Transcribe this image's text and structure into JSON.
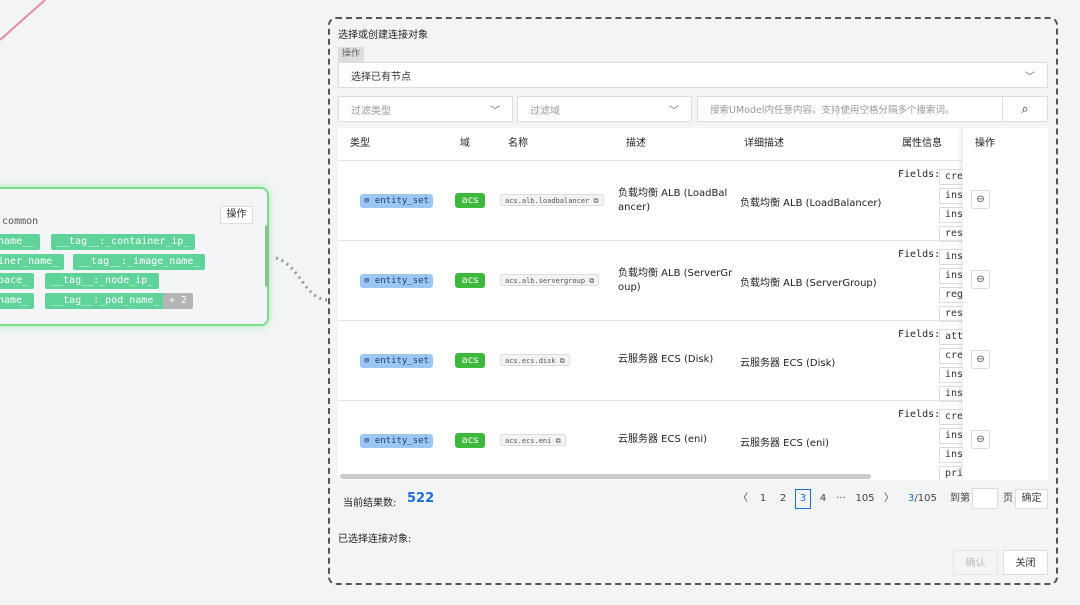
{
  "node": {
    "title": "g.common",
    "op_label": "操作",
    "tags": [
      [
        "tname__",
        "__tag__:_container_ip_"
      ],
      [
        "ainer_name_",
        "__tag__:_image_name_"
      ],
      [
        "space_",
        "__tag__:_node_ip_"
      ],
      [
        "_name_",
        "__tag__:_pod_name_"
      ]
    ],
    "more": "+ 2"
  },
  "panel": {
    "title": "选择或创建连接对象",
    "op_tab": "操作",
    "node_select": "选择已有节点",
    "filter_type": "过滤类型",
    "filter_domain": "过滤域",
    "search_placeholder": "搜索UModel内任意内容。支持使用空格分隔多个搜索词。"
  },
  "table": {
    "headers": [
      "类型",
      "域",
      "名称",
      "描述",
      "详细描述",
      "属性信息",
      "操作"
    ],
    "fields_label": "Fields:",
    "rows": [
      {
        "type": "entity_set",
        "domain": "acs",
        "name": "acs.alb.loadbalancer",
        "desc": "负载均衡 ALB (LoadBalancer)",
        "detail": "负载均衡 ALB (LoadBalancer)",
        "fields": [
          "cre",
          "ins",
          "ins",
          "res"
        ]
      },
      {
        "type": "entity_set",
        "domain": "acs",
        "name": "acs.alb.servergroup",
        "desc": "负载均衡 ALB (ServerGroup)",
        "detail": "负载均衡 ALB (ServerGroup)",
        "fields": [
          "ins",
          "ins",
          "reg",
          "res"
        ]
      },
      {
        "type": "entity_set",
        "domain": "acs",
        "name": "acs.ecs.disk",
        "desc": "云服务器 ECS (Disk)",
        "detail": "云服务器 ECS (Disk)",
        "fields": [
          "att",
          "cre",
          "ins",
          "ins"
        ]
      },
      {
        "type": "entity_set",
        "domain": "acs",
        "name": "acs.ecs.eni",
        "desc": "云服务器 ECS (eni)",
        "detail": "云服务器 ECS (eni)",
        "fields": [
          "cre",
          "ins",
          "ins",
          "pri"
        ]
      }
    ]
  },
  "footer": {
    "count_label": "当前结果数:",
    "count": "522",
    "pages": [
      "1",
      "2",
      "3",
      "4",
      "···",
      "105"
    ],
    "current_page": "3",
    "page_info_cur": "3",
    "page_info_total": "/105",
    "goto_label": "到第",
    "page_unit": "页",
    "goto_confirm": "确定",
    "selected_label": "已选择连接对象:",
    "confirm": "确认",
    "close": "关闭"
  },
  "colors": {
    "accent": "#1a6fd0",
    "tag_green": "#5fd39a",
    "domain_green": "#3fb93b",
    "type_blue": "#9ec6f5"
  }
}
